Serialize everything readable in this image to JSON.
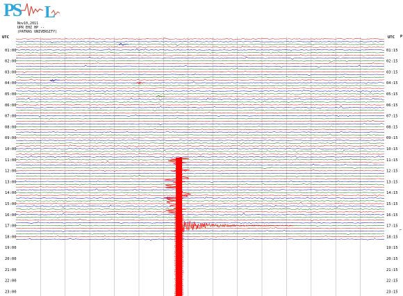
{
  "logo": {
    "text": "PSL"
  },
  "header": {
    "date": "Nov10,2011",
    "station": "UPR EHZ HP --",
    "institution": "(PATRAS UNIVERSITY)"
  },
  "utc_label_left": "UTC",
  "utc_label_right": "UTC",
  "right_edge_letter": "P",
  "stray_mark": "←",
  "colors": {
    "trace_red": "#e02020",
    "trace_blue": "#2020c0",
    "trace_green": "#1f7f1f",
    "event": "#ff0000",
    "grid": "#b8b8b8"
  },
  "chart_data": {
    "type": "line",
    "title": "",
    "xlabel": "",
    "ylabel": "",
    "left_hours": [
      "01:00",
      "02:00",
      "03:00",
      "04:00",
      "05:00",
      "06:00",
      "07:00",
      "08:00",
      "09:00",
      "10:00",
      "11:00",
      "12:00",
      "13:00",
      "14:00",
      "15:00",
      "16:00",
      "17:00",
      "18:00",
      "19:00",
      "20:00",
      "21:00",
      "22:00",
      "23:00"
    ],
    "right_hours": [
      "01:15",
      "02:15",
      "03:15",
      "04:15",
      "05:15",
      "06:15",
      "07:15",
      "08:15",
      "09:15",
      "10:15",
      "11:15",
      "12:15",
      "13:15",
      "14:15",
      "15:15",
      "16:15",
      "17:15",
      "18:15",
      "19:15",
      "20:15",
      "21:15",
      "22:15",
      "23:15"
    ],
    "minutes_per_line": 15,
    "lines_per_hour": 4,
    "total_lines": 74,
    "trace_color_cycle": [
      "red",
      "blue",
      "green"
    ],
    "event": {
      "start_hour": 11.0,
      "start_minute": 6.5,
      "coda_end_hour": 17.0,
      "coda_end_minute": 11.3,
      "clipped_through_hour": 23.25
    },
    "small_events": [
      {
        "hour": 0.5,
        "minute": 4.3,
        "color": "blue"
      },
      {
        "hour": 3.75,
        "minute": 1.5,
        "color": "blue"
      },
      {
        "hour": 4.0,
        "minute": 5.0,
        "color": "red"
      },
      {
        "hour": 5.25,
        "minute": 5.8,
        "color": "green"
      },
      {
        "hour": 14.5,
        "minute": 6.2,
        "color": "blue"
      }
    ]
  }
}
